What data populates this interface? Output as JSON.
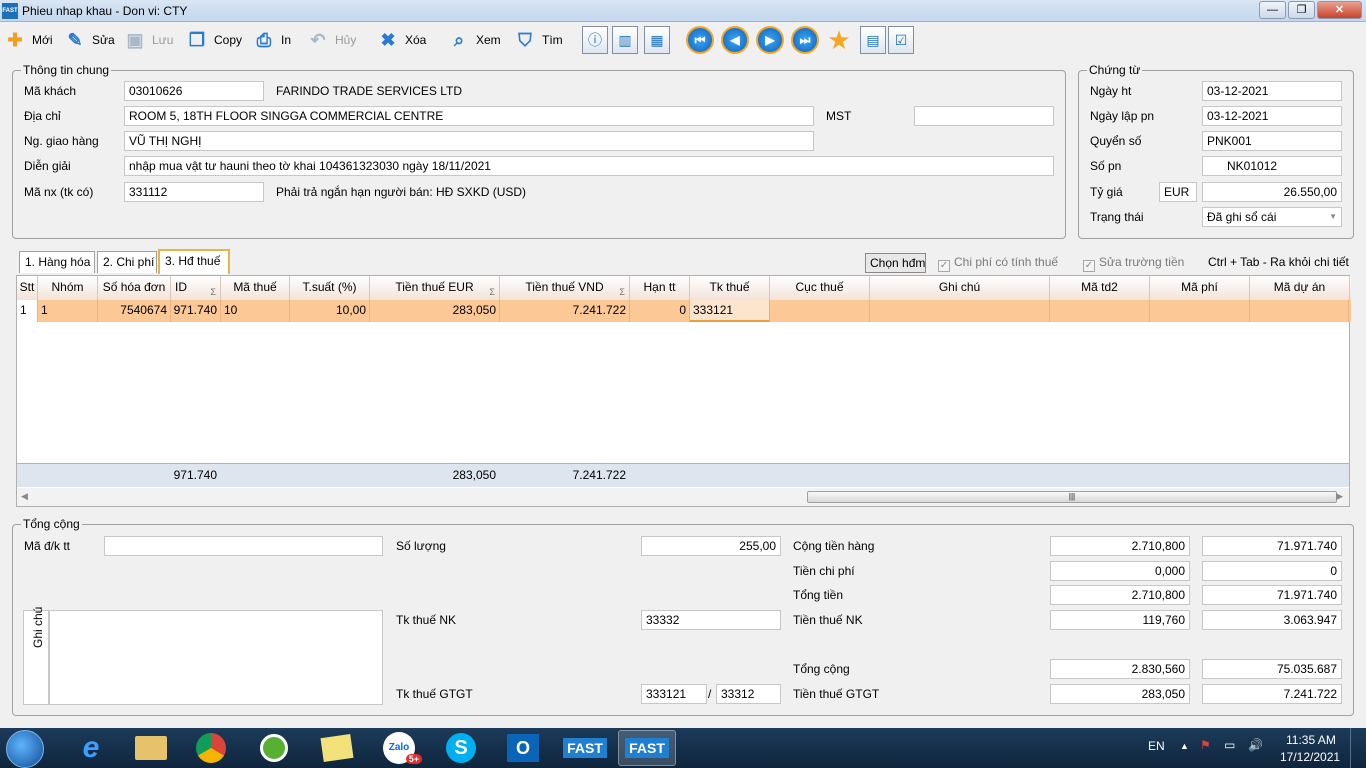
{
  "window": {
    "title": "Phieu nhap khau - Don vi: CTY",
    "app_badge": "FAST",
    "minimize": "—",
    "restore": "❐",
    "close": "✕"
  },
  "toolbar": {
    "new": "Mới",
    "edit": "Sửa",
    "save": "Lưu",
    "copy": "Copy",
    "print": "In",
    "cancel": "Hủy",
    "delete": "Xóa",
    "view": "Xem",
    "find": "Tìm"
  },
  "general": {
    "legend": "Thông tin chung",
    "customer_code_label": "Mã khách",
    "customer_code": "03010626",
    "customer_name": "FARINDO TRADE SERVICES LTD",
    "address_label": "Địa chỉ",
    "address": "ROOM 5, 18TH FLOOR SINGGA COMMERCIAL CENTRE",
    "tax_code_label": "MST",
    "tax_code": "",
    "deliverer_label": "Ng. giao hàng",
    "deliverer": "VŨ THỊ NGHỊ",
    "description_label": "Diễn giải",
    "description": "nhập mua vật tư hauni  theo tờ khai 104361323030 ngày 18/11/2021",
    "account_label": "Mã nx (tk có)",
    "account": "331112",
    "account_desc": "Phải trả ngắn hạn người bán: HĐ SXKD (USD)"
  },
  "voucher": {
    "legend": "Chứng từ",
    "date_label": "Ngày ht",
    "date": "03-12-2021",
    "doc_date_label": "Ngày lập pn",
    "doc_date": "03-12-2021",
    "book_label": "Quyển số",
    "book": "PNK001",
    "number_label": "Số pn",
    "number": "NK01012",
    "rate_label": "Tỷ giá",
    "currency": "EUR",
    "rate": "26.550,00",
    "status_label": "Trạng thái",
    "status": "Đã ghi sổ cái"
  },
  "tabs": [
    "1. Hàng hóa",
    "2. Chi phí",
    "3. Hđ thuế"
  ],
  "options": {
    "choose_invoice": "Chọn hđm",
    "tax_cost": "Chi phí có tính thuế",
    "edit_fields": "Sửa trường tiền",
    "shortcut": "Ctrl + Tab - Ra khỏi chi tiết"
  },
  "grid": {
    "headers": [
      "Stt",
      "Nhóm",
      "Số hóa đơn",
      "ID",
      "Mã thuế",
      "T.suất (%)",
      "Tiền thuế EUR",
      "Tiền thuế VND",
      "Hạn tt",
      "Tk thuế",
      "Cục thuế",
      "Ghi chú",
      "Mã td2",
      "Mã phí",
      "Mã dự án"
    ],
    "sum_mark": "Σ",
    "row": {
      "stt": "1",
      "group": "1",
      "invoice_no": "7540674",
      "id": "971.740",
      "tax_code": "10",
      "rate": "10,00",
      "tax_eur": "283,050",
      "tax_vnd": "7.241.722",
      "due": "0",
      "tax_account": "333121"
    },
    "totals": {
      "id": "971.740",
      "tax_eur": "283,050",
      "tax_vnd": "7.241.722"
    }
  },
  "summary": {
    "legend": "Tổng cộng",
    "payment_label": "Mã đ/k tt",
    "payment": "",
    "note_label": "Ghi chú",
    "note": "",
    "qty_label": "Số lượng",
    "qty": "255,00",
    "import_acc_label": "Tk thuế NK",
    "import_acc": "33332",
    "vat_acc_label": "Tk thuế GTGT",
    "vat_acc": "333121",
    "vat_acc2": "33312",
    "slash": "/",
    "lines": [
      {
        "label": "Cộng tiền hàng",
        "fc": "2.710,800",
        "vnd": "71.971.740"
      },
      {
        "label": "Tiền chi phí",
        "fc": "0,000",
        "vnd": "0"
      },
      {
        "label": "Tổng tiền",
        "fc": "2.710,800",
        "vnd": "71.971.740"
      },
      {
        "label": "Tiền thuế NK",
        "fc": "119,760",
        "vnd": "3.063.947"
      },
      {
        "label": "Tổng cộng",
        "fc": "2.830,560",
        "vnd": "75.035.687"
      },
      {
        "label": "Tiền thuế GTGT",
        "fc": "283,050",
        "vnd": "7.241.722"
      }
    ]
  },
  "taskbar": {
    "apps": [
      "e",
      "Zalo",
      "S",
      "O",
      "FAST",
      "FAST"
    ],
    "zalo_badge": "5+",
    "lang": "EN",
    "time": "11:35 AM",
    "date": "17/12/2021"
  }
}
